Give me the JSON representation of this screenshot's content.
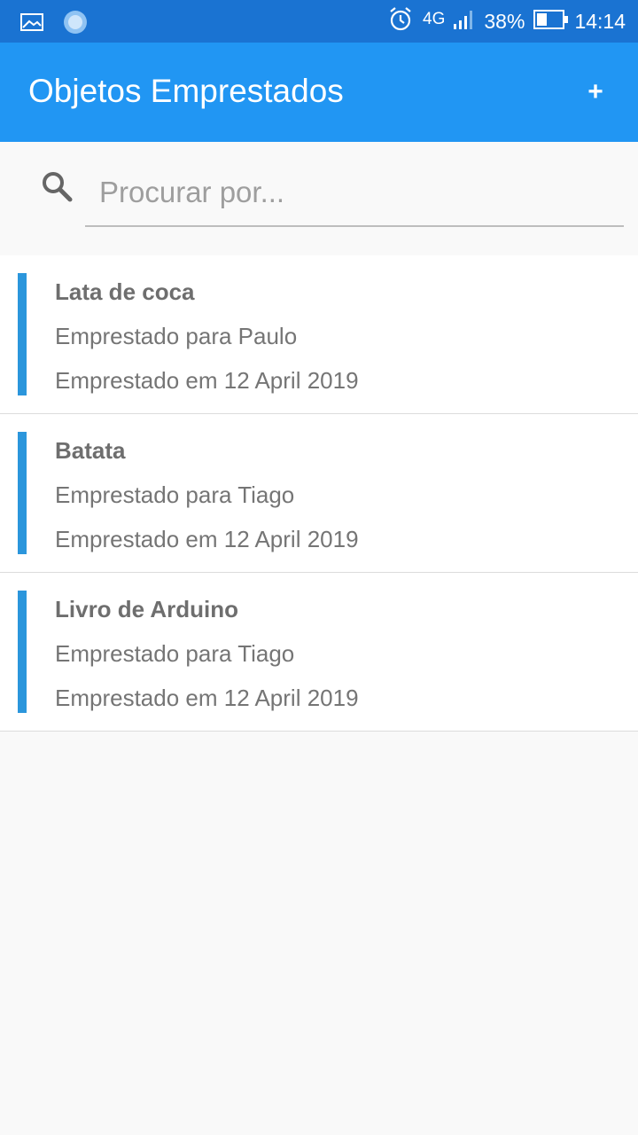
{
  "status_bar": {
    "network": "4G",
    "battery_percent": "38%",
    "time": "14:14",
    "icons": [
      "image-icon",
      "loading-icon",
      "alarm-icon",
      "signal-icon",
      "battery-icon"
    ]
  },
  "app_bar": {
    "title": "Objetos Emprestados",
    "add_label": "+",
    "color": "#2196f3"
  },
  "search": {
    "placeholder": "Procurar por...",
    "value": ""
  },
  "items": [
    {
      "title": "Lata de coca",
      "lent_to": "Emprestado para Paulo",
      "lent_on": "Emprestado em 12 April 2019"
    },
    {
      "title": "Batata",
      "lent_to": "Emprestado para Tiago",
      "lent_on": "Emprestado em 12 April 2019"
    },
    {
      "title": "Livro de Arduino",
      "lent_to": "Emprestado para Tiago",
      "lent_on": "Emprestado em 12 April 2019"
    }
  ],
  "accent_color": "#2b96dc"
}
